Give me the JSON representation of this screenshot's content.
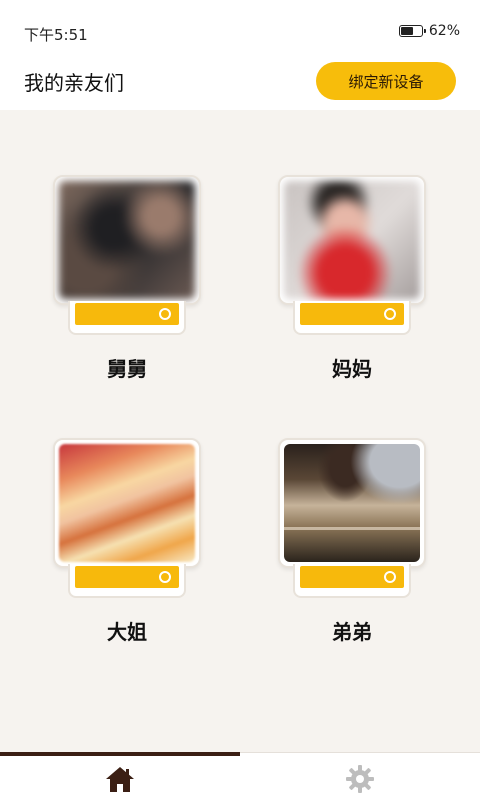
{
  "status_bar": {
    "time": "下午5:51",
    "battery": "62%",
    "battery_level": 0.62
  },
  "header": {
    "title": "我的亲友们",
    "bind_button": "绑定新设备"
  },
  "devices": [
    {
      "name": "舅舅"
    },
    {
      "name": "妈妈"
    },
    {
      "name": "大姐"
    },
    {
      "name": "弟弟"
    }
  ],
  "colors": {
    "accent": "#f7bd0b",
    "nav_active": "#3b1f14",
    "nav_inactive": "#bdbdbd",
    "background": "#f6f3ef"
  },
  "bottom_nav": [
    {
      "icon": "home-icon",
      "active": true
    },
    {
      "icon": "gear-icon",
      "active": false
    }
  ]
}
